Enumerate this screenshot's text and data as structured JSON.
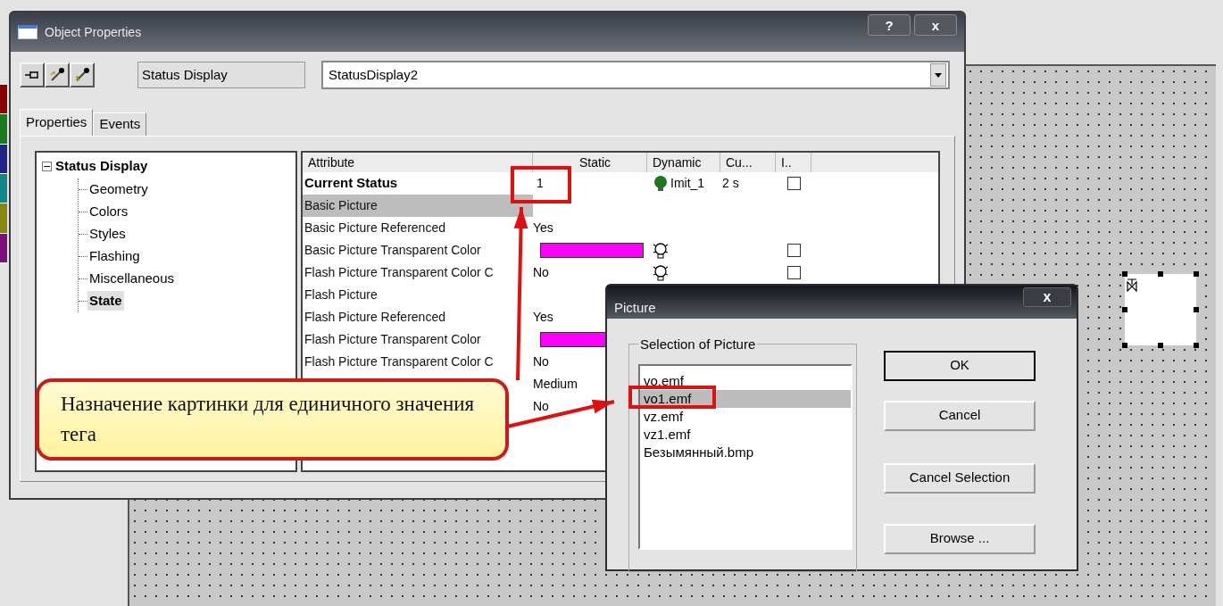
{
  "properties_window": {
    "title": "Object Properties",
    "title_buttons": [
      "?",
      "x"
    ],
    "object_type": "Status Display",
    "object_name": "StatusDisplay2",
    "tabs": [
      {
        "label": "Properties",
        "selected": true
      },
      {
        "label": "Events",
        "selected": false
      }
    ],
    "tree": {
      "label": "Status Display",
      "expanded": true,
      "children": [
        {
          "label": "Geometry",
          "selected": false
        },
        {
          "label": "Colors",
          "selected": false
        },
        {
          "label": "Styles",
          "selected": false
        },
        {
          "label": "Flashing",
          "selected": false
        },
        {
          "label": "Miscellaneous",
          "selected": false
        },
        {
          "label": "State",
          "selected": true
        }
      ]
    },
    "table": {
      "columns": [
        "Attribute",
        "Static",
        "Dynamic",
        "Cu...",
        "I.."
      ],
      "rows": [
        {
          "attribute": "Current Status",
          "bold": true,
          "selected": false,
          "static": "1",
          "bulb_lit": true,
          "dynamic": "Imit_1",
          "cycle": "2 s",
          "indirect": false
        },
        {
          "attribute": "Basic Picture",
          "bold": false,
          "selected": true
        },
        {
          "attribute": "Basic Picture Referenced",
          "bold": false,
          "selected": false,
          "static": "Yes"
        },
        {
          "attribute": "Basic Picture Transparent Color",
          "bold": false,
          "selected": false,
          "color": "#ff00ff",
          "bulb_lit": false,
          "indirect": false
        },
        {
          "attribute": "Flash Picture Transparent Color C",
          "bold": false,
          "selected": false,
          "static": "No",
          "bulb_lit": false,
          "indirect": false
        },
        {
          "attribute": "Flash Picture",
          "bold": false,
          "selected": false
        },
        {
          "attribute": "Flash Picture Referenced",
          "bold": false,
          "selected": false,
          "static": "Yes"
        },
        {
          "attribute": "Flash Picture Transparent Color",
          "bold": false,
          "selected": false,
          "color": "#ff00ff"
        },
        {
          "attribute": "Flash Picture Transparent Color C",
          "bold": false,
          "selected": false,
          "static": "No"
        },
        {
          "static": "Medium"
        },
        {
          "static": "No"
        }
      ]
    }
  },
  "picture_dialog": {
    "title": "Picture",
    "close": "x",
    "group": "Selection of Picture",
    "items": [
      {
        "label": "vo.emf",
        "selected": false
      },
      {
        "label": "vo1.emf",
        "selected": true
      },
      {
        "label": "vz.emf",
        "selected": false
      },
      {
        "label": "vz1.emf",
        "selected": false
      },
      {
        "label": "Безымянный.bmp",
        "selected": false
      }
    ],
    "buttons": [
      {
        "label": "OK",
        "default": true
      },
      {
        "label": "Cancel",
        "default": false
      },
      {
        "label": "Cancel Selection",
        "default": false
      },
      {
        "label": "Browse ...",
        "default": false
      }
    ]
  },
  "callout": {
    "text": "Назначение картинки для единичного значения тега"
  }
}
